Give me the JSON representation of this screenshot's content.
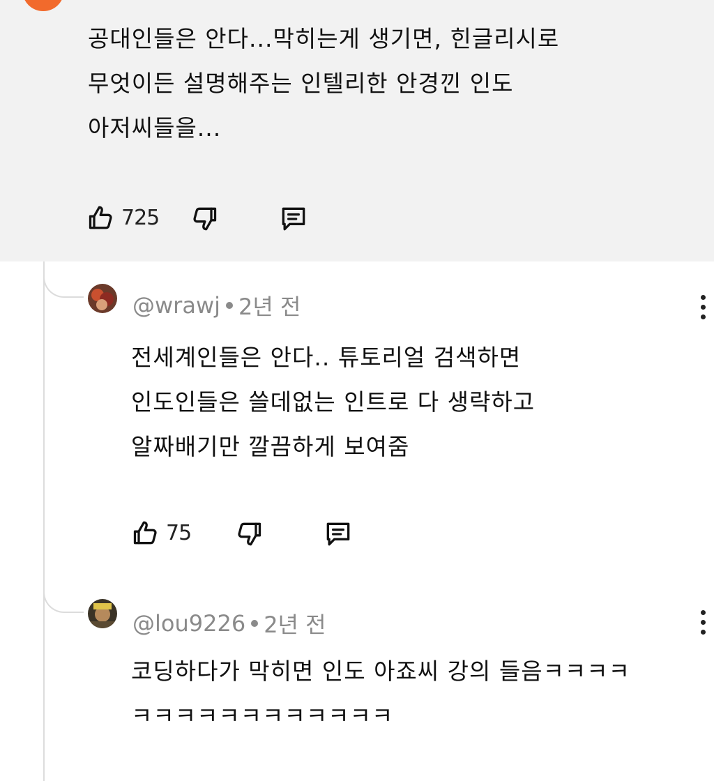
{
  "parent": {
    "body": "공대인들은 안다...막히는게 생기면, 힌글리시로\n무엇이든 설명해주는 인텔리한 안경낀 인도\n아저씨들을...",
    "likes": "725"
  },
  "replies": [
    {
      "author": "@wrawj",
      "time": "2년 전",
      "body": "전세계인들은 안다.. 튜토리얼 검색하면\n인도인들은 쓸데없는 인트로 다 생략하고\n알짜배기만 깔끔하게 보여줌",
      "likes": "75"
    },
    {
      "author": "@lou9226",
      "time": "2년 전",
      "body": "코딩하다가 막히면 인도 아죠씨 강의 들음ㅋㅋㅋㅋ\nㅋㅋㅋㅋㅋㅋㅋㅋㅋㅋㅋㅋ"
    }
  ],
  "colors": {
    "accent": "#f26a2c",
    "parent_bg": "#f2f2f2",
    "meta": "#8a8a8a"
  },
  "icons": [
    "like-icon",
    "dislike-icon",
    "reply-icon",
    "more-vert-icon"
  ]
}
